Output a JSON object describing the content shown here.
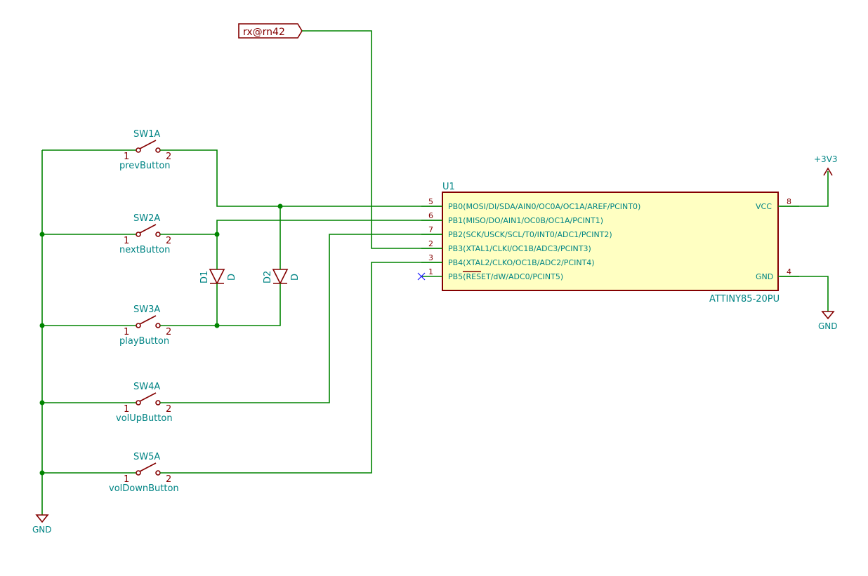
{
  "global_label": {
    "text": "rx@rn42"
  },
  "ic": {
    "ref": "U1",
    "value": "ATTINY85-20PU",
    "left_pins": [
      {
        "num": "5",
        "name": "PB0(MOSI/DI/SDA/AIN0/OC0A/OC1A/AREF/PCINT0)"
      },
      {
        "num": "6",
        "name": "PB1(MISO/DO/AIN1/OC0B/OC1A/PCINT1)"
      },
      {
        "num": "7",
        "name": "PB2(SCK/USCK/SCL/T0/INT0/ADC1/PCINT2)"
      },
      {
        "num": "2",
        "name": "PB3(XTAL1/CLKI/OC1B/ADC3/PCINT3)"
      },
      {
        "num": "3",
        "name": "PB4(XTAL2/CLKO/OC1B/ADC2/PCINT4)"
      },
      {
        "num": "1",
        "name": "PB5(RESET/dW/ADC0/PCINT5)"
      }
    ],
    "right_pins": [
      {
        "num": "8",
        "name": "VCC"
      },
      {
        "num": "4",
        "name": "GND"
      }
    ]
  },
  "switches": [
    {
      "ref": "SW1A",
      "value": "prevButton",
      "pin1": "1",
      "pin2": "2"
    },
    {
      "ref": "SW2A",
      "value": "nextButton",
      "pin1": "1",
      "pin2": "2"
    },
    {
      "ref": "SW3A",
      "value": "playButton",
      "pin1": "1",
      "pin2": "2"
    },
    {
      "ref": "SW4A",
      "value": "volUpButton",
      "pin1": "1",
      "pin2": "2"
    },
    {
      "ref": "SW5A",
      "value": "volDownButton",
      "pin1": "1",
      "pin2": "2"
    }
  ],
  "diodes": [
    {
      "ref": "D1",
      "value": "D"
    },
    {
      "ref": "D2",
      "value": "D"
    }
  ],
  "power": {
    "vcc": "+3V3",
    "gnd_ic": "GND",
    "gnd_switches": "GND"
  },
  "colors": {
    "wire": "#008400",
    "component": "#840000",
    "text": "#008484",
    "ic_fill": "#ffffc2"
  }
}
